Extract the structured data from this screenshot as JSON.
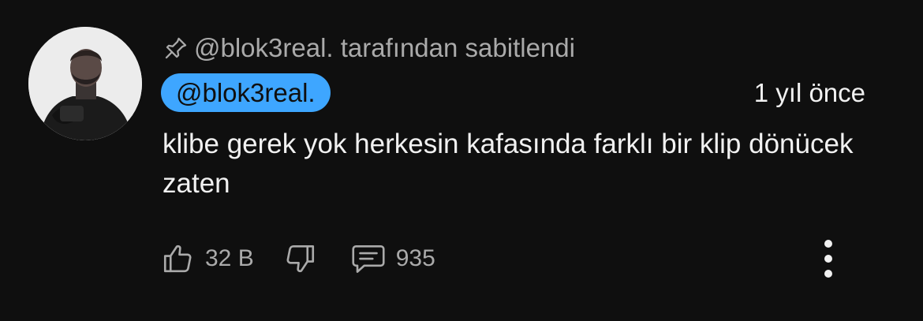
{
  "comment": {
    "pinned_by_label": "@blok3real. tarafından sabitlendi",
    "author": "@blok3real.",
    "timestamp": "1 yıl önce",
    "text": "klibe gerek yok herkesin kafasında farklı bir klip dönücek zaten",
    "likes": "32 B",
    "replies": "935",
    "author_chip_color": "#3ea6ff"
  },
  "icons": {
    "pin": "pin-icon",
    "like": "thumbs-up-icon",
    "dislike": "thumbs-down-icon",
    "reply": "comment-icon",
    "more": "more-vertical-icon"
  }
}
